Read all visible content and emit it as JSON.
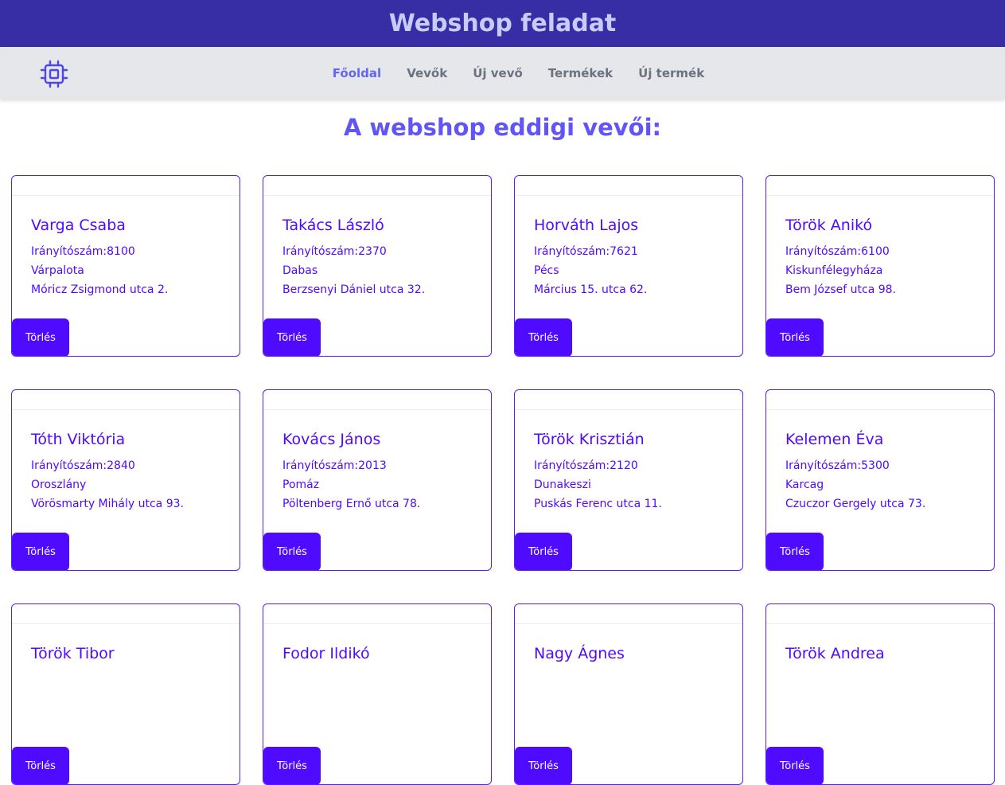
{
  "header": {
    "title": "Webshop feladat"
  },
  "nav": {
    "logo_icon": "cpu-chip-icon",
    "links": [
      "Főoldal",
      "Vevők",
      "Új vevő",
      "Termékek",
      "Új termék"
    ],
    "active": "Főoldal"
  },
  "main": {
    "title": "A webshop eddigi vevői:",
    "delete_label": "Törlés",
    "customers": [
      {
        "name": "Varga Csaba",
        "zip": "Irányítószám:8100",
        "city": "Várpalota",
        "address": "Móricz Zsigmond utca 2."
      },
      {
        "name": "Takács László",
        "zip": "Irányítószám:2370",
        "city": "Dabas",
        "address": "Berzsenyi Dániel utca 32."
      },
      {
        "name": "Horváth Lajos",
        "zip": "Irányítószám:7621",
        "city": "Pécs",
        "address": "Március 15. utca 62."
      },
      {
        "name": "Török Anikó",
        "zip": "Irányítószám:6100",
        "city": "Kiskunfélegyháza",
        "address": "Bem József utca 98."
      },
      {
        "name": "Tóth Viktória",
        "zip": "Irányítószám:2840",
        "city": "Oroszlány",
        "address": "Vörösmarty Mihály utca 93."
      },
      {
        "name": "Kovács János",
        "zip": "Irányítószám:2013",
        "city": "Pomáz",
        "address": "Pöltenberg Ernő utca 78."
      },
      {
        "name": "Török Krisztián",
        "zip": "Irányítószám:2120",
        "city": "Dunakeszi",
        "address": "Puskás Ferenc utca 11."
      },
      {
        "name": "Kelemen Éva",
        "zip": "Irányítószám:5300",
        "city": "Karcag",
        "address": "Czuczor Gergely utca 73."
      },
      {
        "name": "Török Tibor",
        "zip": "",
        "city": "",
        "address": ""
      },
      {
        "name": "Fodor Ildikó",
        "zip": "",
        "city": "",
        "address": ""
      },
      {
        "name": "Nagy Ágnes",
        "zip": "",
        "city": "",
        "address": ""
      },
      {
        "name": "Török Andrea",
        "zip": "",
        "city": "",
        "address": ""
      }
    ]
  },
  "colors": {
    "header_bg": "#372ea6",
    "header_text": "#c7cdfb",
    "accent": "#4f0bff",
    "nav_active": "#6366f1",
    "nav_bg": "#e5e7eb"
  }
}
